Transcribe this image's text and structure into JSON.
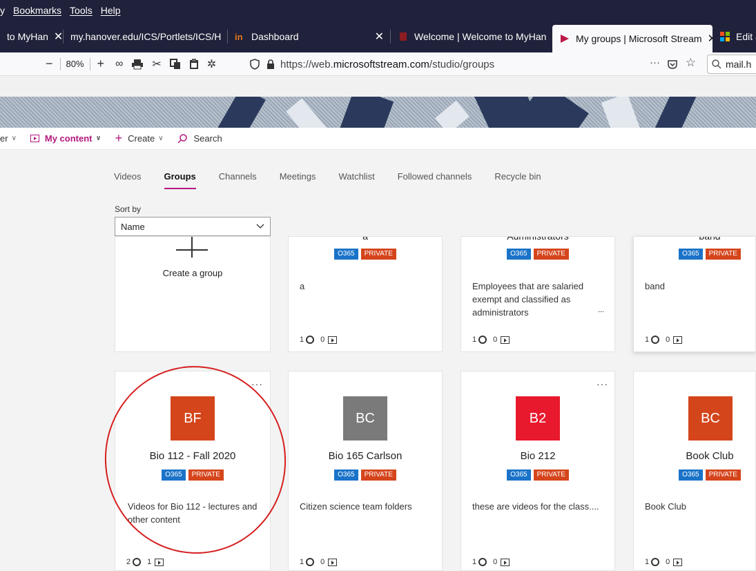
{
  "menubar": {
    "items": [
      "y",
      "Bookmarks",
      "Tools",
      "Help"
    ]
  },
  "tabs": [
    {
      "title": "to MyHan",
      "close": "✕"
    },
    {
      "title": "my.hanover.edu/ICS/Portlets/ICS/H",
      "close": "✕"
    },
    {
      "title": "Dashboard",
      "close": "✕"
    },
    {
      "title": "Welcome | Welcome to MyHan",
      "close": "✕"
    },
    {
      "title": "My groups | Microsoft Stream",
      "close": "✕"
    },
    {
      "title": "Edit a",
      "close": ""
    }
  ],
  "toolbar": {
    "zoom": "80%",
    "url_prefix": "https://web.",
    "url_domain": "microsoftstream.com",
    "url_path": "/studio/groups",
    "search": "mail.h",
    "more": "···"
  },
  "appnav": {
    "left_fragment": "er",
    "my_content": "My content",
    "create": "Create",
    "search": "Search"
  },
  "subtabs": [
    "Videos",
    "Groups",
    "Channels",
    "Meetings",
    "Watchlist",
    "Followed channels",
    "Recycle bin"
  ],
  "sort": {
    "label": "Sort by",
    "value": "Name"
  },
  "badges": {
    "o365": "O365",
    "private": "PRIVATE"
  },
  "create_card": {
    "label": "Create a group"
  },
  "top_cards": [
    {
      "name_fragment": "a",
      "desc": "a",
      "members": "1",
      "videos": "0"
    },
    {
      "name_fragment": "Administrators",
      "desc": "Employees that are salaried exempt and classified as administrators",
      "ellipsis": "...",
      "members": "1",
      "videos": "0"
    },
    {
      "name_fragment": "band",
      "desc": "band",
      "members": "1",
      "videos": "0"
    }
  ],
  "bottom_cards": [
    {
      "initials": "BF",
      "color": "#d4451b",
      "name": "Bio 112 - Fall 2020",
      "desc": "Videos for Bio 112 - lectures and other content",
      "members": "2",
      "videos": "1"
    },
    {
      "initials": "BC",
      "color": "#7a7a7a",
      "name": "Bio 165 Carlson",
      "desc": "Citizen science team folders",
      "members": "1",
      "videos": "0"
    },
    {
      "initials": "B2",
      "color": "#e8192c",
      "name": "Bio 212",
      "desc": "these are videos for the class....",
      "members": "1",
      "videos": "0"
    },
    {
      "initials": "BC",
      "color": "#d4451b",
      "name": "Book Club",
      "desc": "Book Club",
      "members": "1",
      "videos": "0"
    }
  ]
}
